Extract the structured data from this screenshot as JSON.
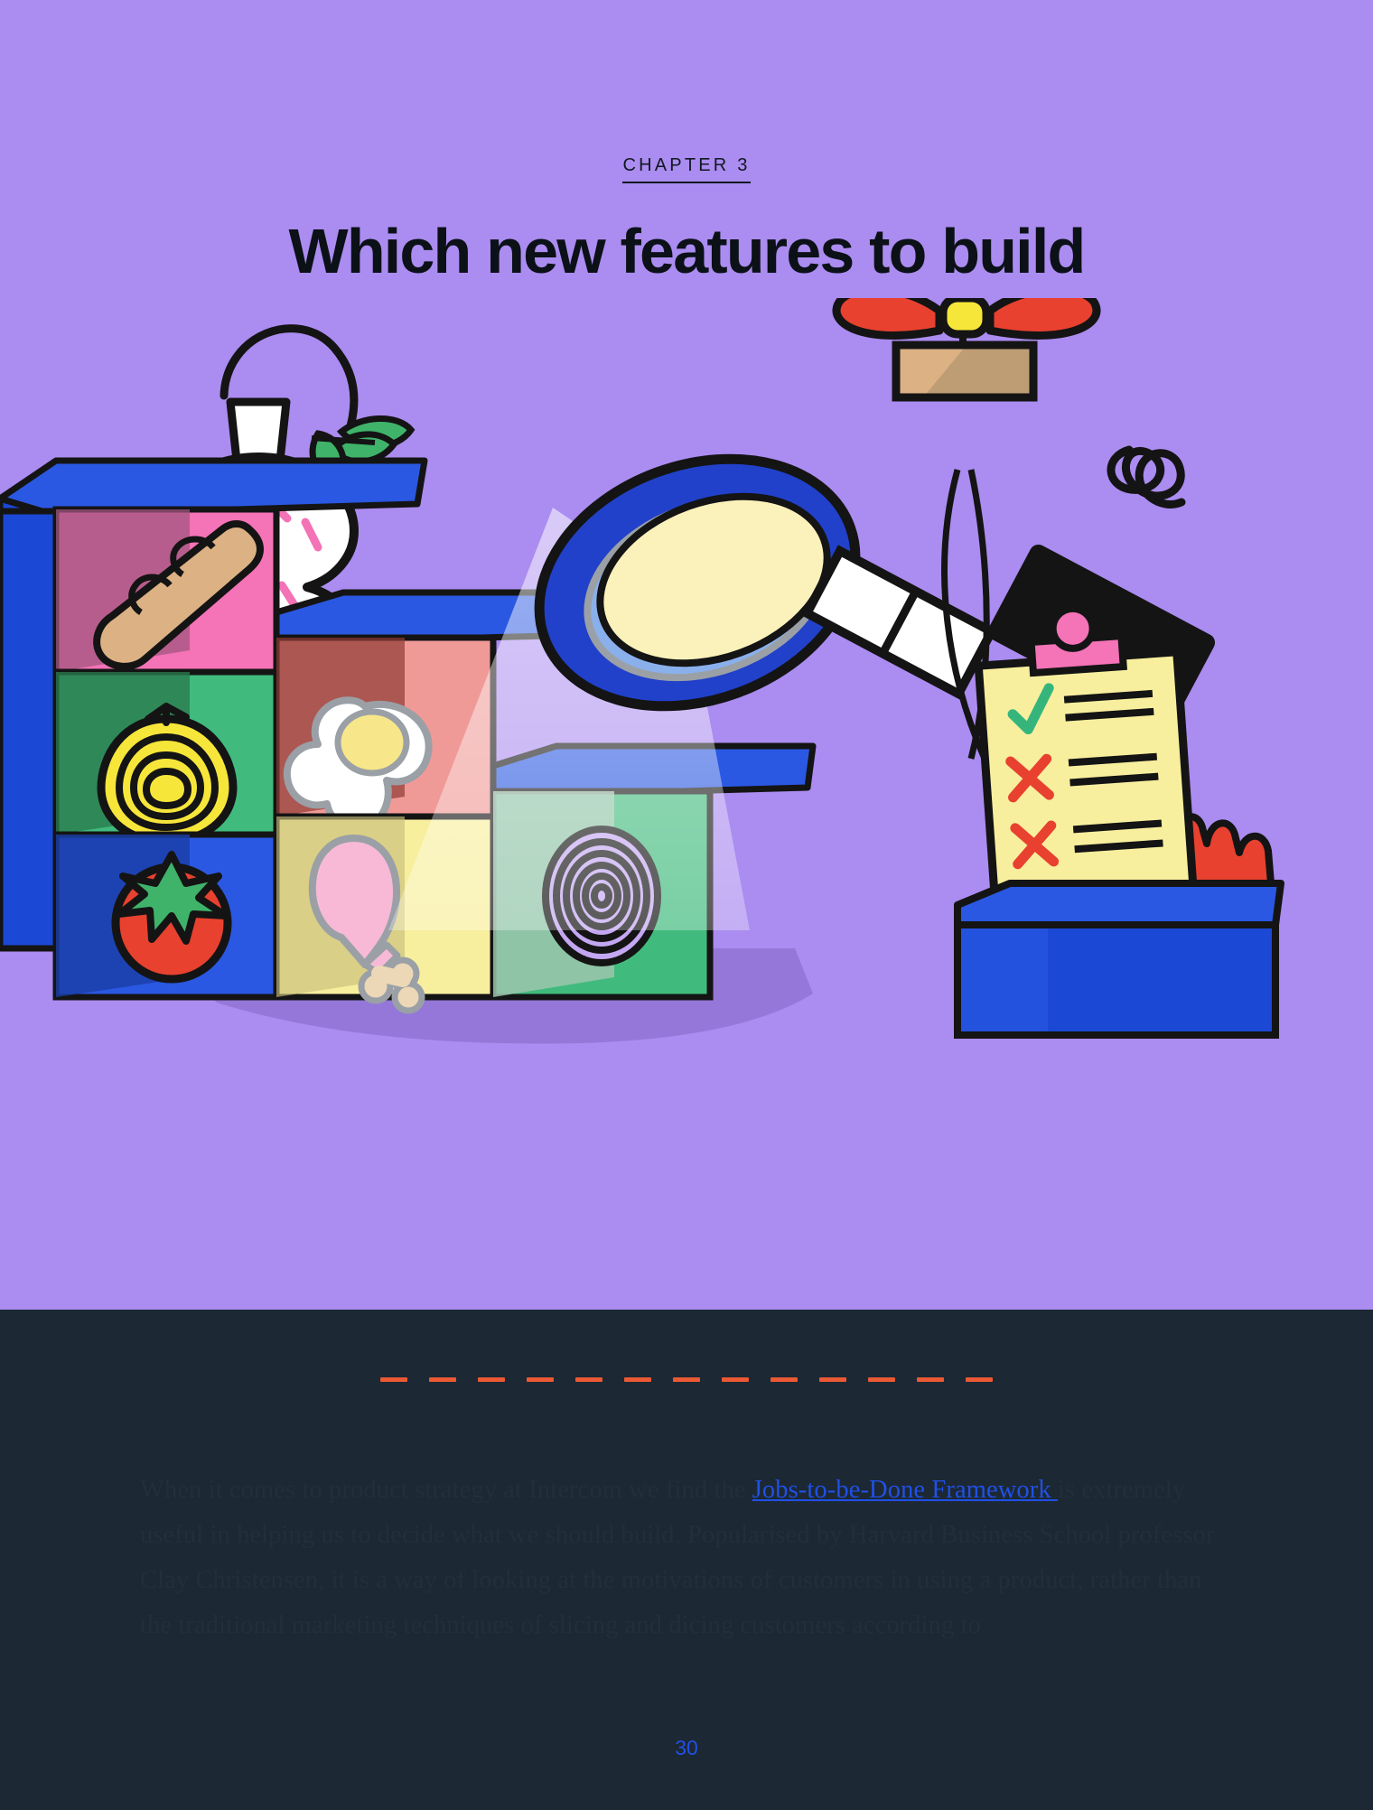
{
  "theme": {
    "hero_bg": "#ab8cf0",
    "dark_bg": "#1c2833",
    "accent_orange": "#ea5934",
    "link_blue": "#2050e8",
    "title_color": "#0b1117",
    "body_text_color": "#222f3b"
  },
  "header": {
    "chapter_label": "CHAPTER 3",
    "title": "Which new features to build"
  },
  "illustration": {
    "alt_name": "shelf-of-ingredients-with-magnifying-glass",
    "elements": [
      "vase-with-sprinkles",
      "drooping-leaf",
      "blue-shelf-unit",
      "baguette-bread",
      "yellow-onion",
      "tomato",
      "fried-egg",
      "chicken-drumstick",
      "sliced-purple-onion",
      "magnifying-glass",
      "black-sleeve-arm",
      "propeller-drone",
      "squiggle-doodle",
      "clipboard-checklist",
      "red-hand",
      "blue-box"
    ],
    "clipboard": {
      "check_mark": "✓",
      "cross_marks": [
        "✕",
        "✕"
      ]
    }
  },
  "body": {
    "paragraph_parts": [
      {
        "type": "text",
        "value": "When it comes to product strategy at Intercom we find the "
      },
      {
        "type": "link",
        "value": "Jobs-to-be-Done Framework "
      },
      {
        "type": "text",
        "value": "is extremely useful in helping us to decide what we should build. Popularised by Harvard Business School professor Clay Christensen, it is a way of looking at the motivations of customers in using a product, rather than the traditional marketing techniques of slicing and dicing customers according to"
      }
    ]
  },
  "footer": {
    "page_number": "30"
  }
}
